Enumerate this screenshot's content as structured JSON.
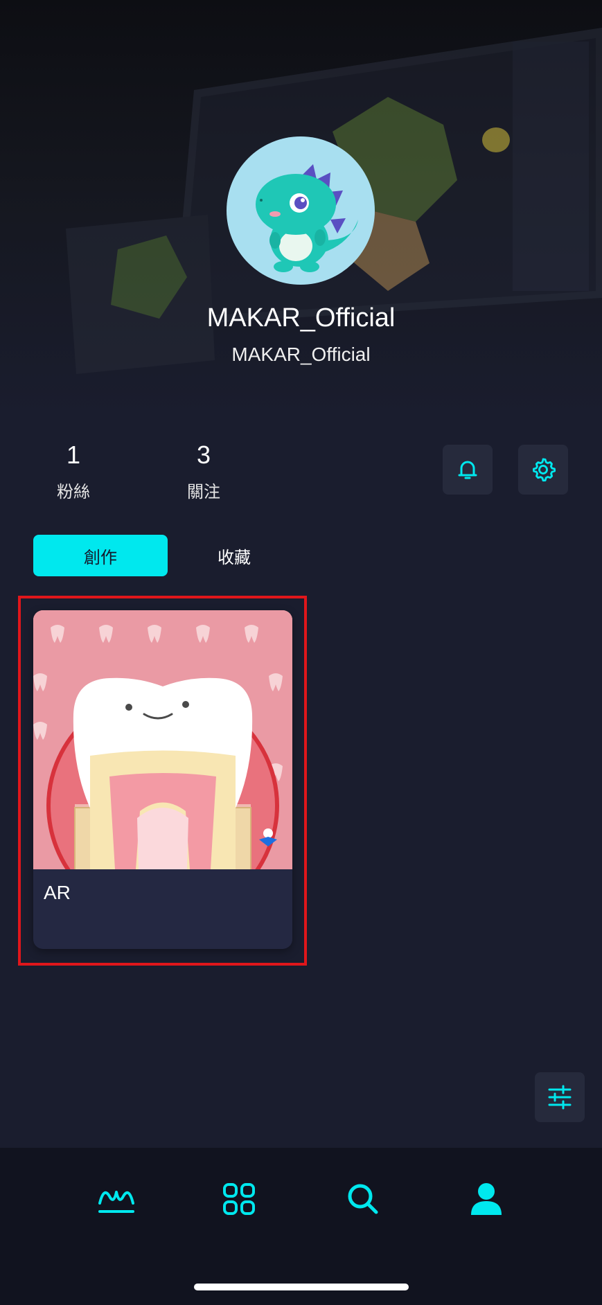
{
  "profile": {
    "display_name": "MAKAR_Official",
    "user_id": "MAKAR_Official"
  },
  "stats": {
    "fans_count": "1",
    "fans_label": "粉絲",
    "following_count": "3",
    "following_label": "關注"
  },
  "tabs": [
    {
      "label": "創作",
      "active": true
    },
    {
      "label": "收藏",
      "active": false
    }
  ],
  "projects": [
    {
      "title": "AR",
      "thumbnail": "tooth-illustration"
    }
  ],
  "icons": {
    "notifications": "bell-icon",
    "settings": "gear-icon",
    "filter": "sliders-icon",
    "nav": [
      "makar-home-icon",
      "grid-icon",
      "search-icon",
      "user-icon"
    ]
  },
  "colors": {
    "accent": "#00e8ee",
    "background": "#1a1d2e",
    "card": "#242842",
    "highlight": "#e0161b"
  }
}
